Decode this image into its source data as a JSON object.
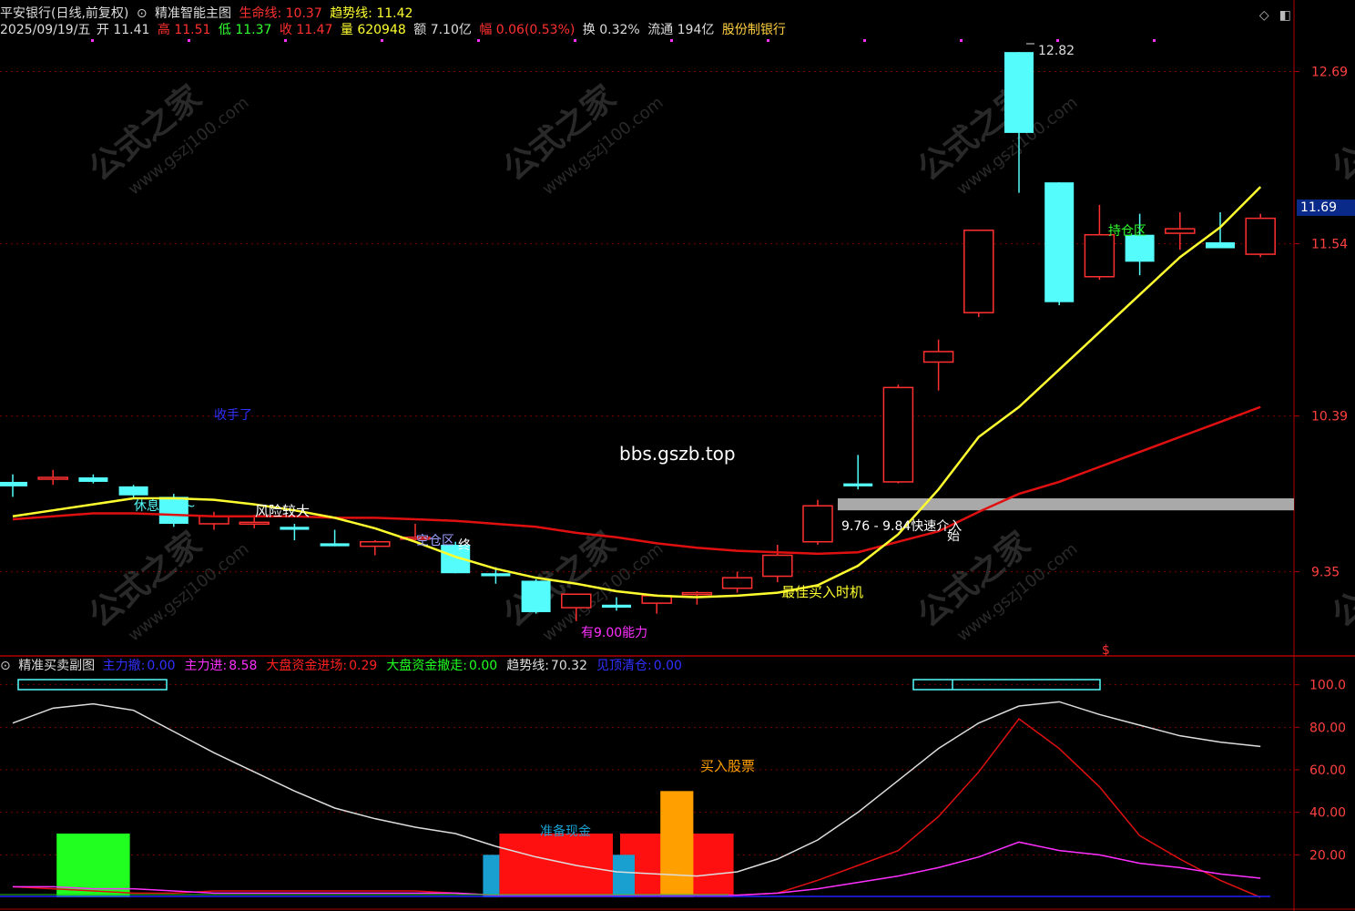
{
  "header1": {
    "stock": "平安银行(日线,前复权)",
    "indicator": "精准智能主图",
    "lifeline_label": "生命线:",
    "lifeline_value": "10.37",
    "trend_label": "趋势线:",
    "trend_value": "11.42"
  },
  "header2": {
    "date": "2025/09/19/五",
    "open_label": "开",
    "open": "11.41",
    "high_label": "高",
    "high": "11.51",
    "low_label": "低",
    "low": "11.37",
    "close_label": "收",
    "close": "11.47",
    "volume_label": "量",
    "volume": "620948",
    "amount_label": "额",
    "amount": "7.10亿",
    "change_label": "幅",
    "change": "0.06(0.53%)",
    "turnover_label": "换",
    "turnover": "0.32%",
    "float_label": "流通",
    "float": "194亿",
    "sector": "股份制银行"
  },
  "sub_header": {
    "title": "精准买卖副图",
    "items": [
      {
        "label": "主力撤:",
        "value": "0.00",
        "color": "#3030ff"
      },
      {
        "label": "主力进:",
        "value": "8.58",
        "color": "#ff30ff"
      },
      {
        "label": "大盘资金进场:",
        "value": "0.29",
        "color": "#ff2020"
      },
      {
        "label": "大盘资金撤走:",
        "value": "0.00",
        "color": "#20ff20"
      },
      {
        "label": "趋势线:",
        "value": "70.32",
        "color": "#dddddd"
      },
      {
        "label": "见顶清仓:",
        "value": "0.00",
        "color": "#3030ff"
      }
    ]
  },
  "price_axis": {
    "ticks": [
      "12.69",
      "11.54",
      "10.39",
      "9.35"
    ],
    "current": "11.69"
  },
  "sub_axis": {
    "ticks": [
      "100.0",
      "80.00",
      "60.00",
      "40.00",
      "20.00"
    ]
  },
  "annotations": {
    "watermark_site": "bbs.gszb.top",
    "stop_hand": "收手了",
    "rest_watch": "休息观望~",
    "risk_high": "风险较大",
    "empty_zone": "空仓区",
    "end": "终",
    "support": "有9.00能力",
    "best_buy": "最佳买入时机",
    "quick_entry": "9.76 - 9.84快速介入",
    "start": "始",
    "hold_zone": "持仓区",
    "high_mark": "12.82",
    "s_mark": "$",
    "buy_stock": "买入股票",
    "prepare": "准备现金",
    "wm_text": "公式之家",
    "wm_url": "www.gszj100.com"
  },
  "colors": {
    "up": "#ff3030",
    "down": "#54fcfc",
    "lifeline": "#e01010",
    "trend": "#ffff30",
    "grid": "#7a0000"
  },
  "chart_data": [
    {
      "type": "candlestick",
      "title": "精准智能主图",
      "ylim": [
        8.8,
        12.9
      ],
      "candles": [
        {
          "o": 9.95,
          "h": 10.0,
          "l": 9.85,
          "c": 9.92
        },
        {
          "o": 9.98,
          "h": 10.03,
          "l": 9.93,
          "c": 9.98
        },
        {
          "o": 9.98,
          "h": 10.0,
          "l": 9.94,
          "c": 9.95
        },
        {
          "o": 9.92,
          "h": 9.93,
          "l": 9.84,
          "c": 9.86
        },
        {
          "o": 9.85,
          "h": 9.87,
          "l": 9.65,
          "c": 9.67
        },
        {
          "o": 9.67,
          "h": 9.75,
          "l": 9.63,
          "c": 9.72
        },
        {
          "o": 9.68,
          "h": 9.73,
          "l": 9.64,
          "c": 9.68
        },
        {
          "o": 9.65,
          "h": 9.67,
          "l": 9.56,
          "c": 9.63
        },
        {
          "o": 9.54,
          "h": 9.63,
          "l": 9.52,
          "c": 9.52
        },
        {
          "o": 9.52,
          "h": 9.56,
          "l": 9.46,
          "c": 9.55
        },
        {
          "o": 9.57,
          "h": 9.67,
          "l": 9.56,
          "c": 9.58
        },
        {
          "o": 9.53,
          "h": 9.55,
          "l": 9.34,
          "c": 9.34
        },
        {
          "o": 9.34,
          "h": 9.38,
          "l": 9.27,
          "c": 9.32
        },
        {
          "o": 9.29,
          "h": 9.3,
          "l": 9.07,
          "c": 9.08
        },
        {
          "o": 9.11,
          "h": 9.14,
          "l": 9.02,
          "c": 9.2
        },
        {
          "o": 9.13,
          "h": 9.18,
          "l": 9.09,
          "c": 9.11
        },
        {
          "o": 9.14,
          "h": 9.2,
          "l": 9.07,
          "c": 9.19
        },
        {
          "o": 9.2,
          "h": 9.22,
          "l": 9.13,
          "c": 9.21
        },
        {
          "o": 9.24,
          "h": 9.35,
          "l": 9.21,
          "c": 9.31
        },
        {
          "o": 9.32,
          "h": 9.53,
          "l": 9.28,
          "c": 9.46
        },
        {
          "o": 9.55,
          "h": 9.83,
          "l": 9.53,
          "c": 9.79
        },
        {
          "o": 9.94,
          "h": 10.13,
          "l": 9.9,
          "c": 9.92
        },
        {
          "o": 9.95,
          "h": 10.6,
          "l": 9.94,
          "c": 10.58
        },
        {
          "o": 10.75,
          "h": 10.9,
          "l": 10.56,
          "c": 10.82
        },
        {
          "o": 11.08,
          "h": 11.6,
          "l": 11.05,
          "c": 11.63
        },
        {
          "o": 12.82,
          "h": 12.82,
          "l": 11.88,
          "c": 12.28
        },
        {
          "o": 11.95,
          "h": 11.95,
          "l": 11.13,
          "c": 11.15
        },
        {
          "o": 11.32,
          "h": 11.8,
          "l": 11.3,
          "c": 11.6
        },
        {
          "o": 11.6,
          "h": 11.74,
          "l": 11.33,
          "c": 11.42
        },
        {
          "o": 11.61,
          "h": 11.75,
          "l": 11.5,
          "c": 11.64
        },
        {
          "o": 11.55,
          "h": 11.75,
          "l": 11.52,
          "c": 11.51
        },
        {
          "o": 11.47,
          "h": 11.74,
          "l": 11.45,
          "c": 11.71
        }
      ],
      "series": [
        {
          "name": "生命线",
          "values": [
            9.7,
            9.72,
            9.74,
            9.74,
            9.73,
            9.72,
            9.72,
            9.72,
            9.71,
            9.71,
            9.7,
            9.69,
            9.67,
            9.65,
            9.61,
            9.58,
            9.54,
            9.51,
            9.49,
            9.48,
            9.47,
            9.48,
            9.55,
            9.62,
            9.75,
            9.87,
            9.95,
            10.05,
            10.15,
            10.25,
            10.35,
            10.45
          ]
        },
        {
          "name": "趋势线",
          "values": [
            9.72,
            9.76,
            9.8,
            9.84,
            9.84,
            9.83,
            9.8,
            9.76,
            9.71,
            9.64,
            9.55,
            9.45,
            9.37,
            9.31,
            9.27,
            9.22,
            9.19,
            9.18,
            9.19,
            9.21,
            9.26,
            9.39,
            9.6,
            9.9,
            10.25,
            10.45,
            10.7,
            10.95,
            11.2,
            11.45,
            11.65,
            11.92
          ]
        }
      ],
      "zones": [
        {
          "label": "9.76 - 9.84快速介入",
          "from": 9.76,
          "to": 9.84
        }
      ]
    },
    {
      "type": "line",
      "title": "精准买卖副图",
      "ylim": [
        0,
        105
      ],
      "series": [
        {
          "name": "趋势线",
          "values": [
            82,
            89,
            91,
            88,
            78,
            68,
            59,
            50,
            42,
            37,
            33,
            30,
            24,
            19,
            15,
            12,
            11,
            10,
            12,
            18,
            27,
            40,
            55,
            70,
            82,
            90,
            92,
            86,
            81,
            76,
            73,
            71
          ]
        },
        {
          "name": "大盘资金进场",
          "values": [
            5,
            4,
            3,
            2,
            2,
            3,
            3,
            3,
            3,
            3,
            3,
            2,
            1,
            1,
            1,
            1,
            1,
            1,
            1,
            2,
            8,
            15,
            22,
            38,
            59,
            84,
            70,
            52,
            29,
            18,
            8,
            0
          ]
        },
        {
          "name": "主力进",
          "values": [
            5,
            5,
            4,
            4,
            3,
            2,
            2,
            2,
            2,
            2,
            2,
            2,
            1,
            1,
            1,
            1,
            1,
            1,
            1,
            2,
            4,
            7,
            10,
            14,
            19,
            26,
            22,
            20,
            16,
            14,
            11,
            9
          ]
        }
      ],
      "bars": [
        {
          "label": "大盘资金撤走",
          "from_index": 1,
          "to_index": 3,
          "value": 30,
          "color": "#20ff20"
        },
        {
          "label": "准备现金",
          "from_index": 12,
          "to_index": 15,
          "value": 30,
          "color": "#ff1010"
        },
        {
          "label": "准备现金",
          "from_index": 15,
          "to_index": 18,
          "value": 30,
          "color": "#ff1010"
        },
        {
          "label": "买入股票",
          "from_index": 16,
          "to_index": 17,
          "value": 50,
          "color": "#ffa000"
        }
      ]
    }
  ]
}
